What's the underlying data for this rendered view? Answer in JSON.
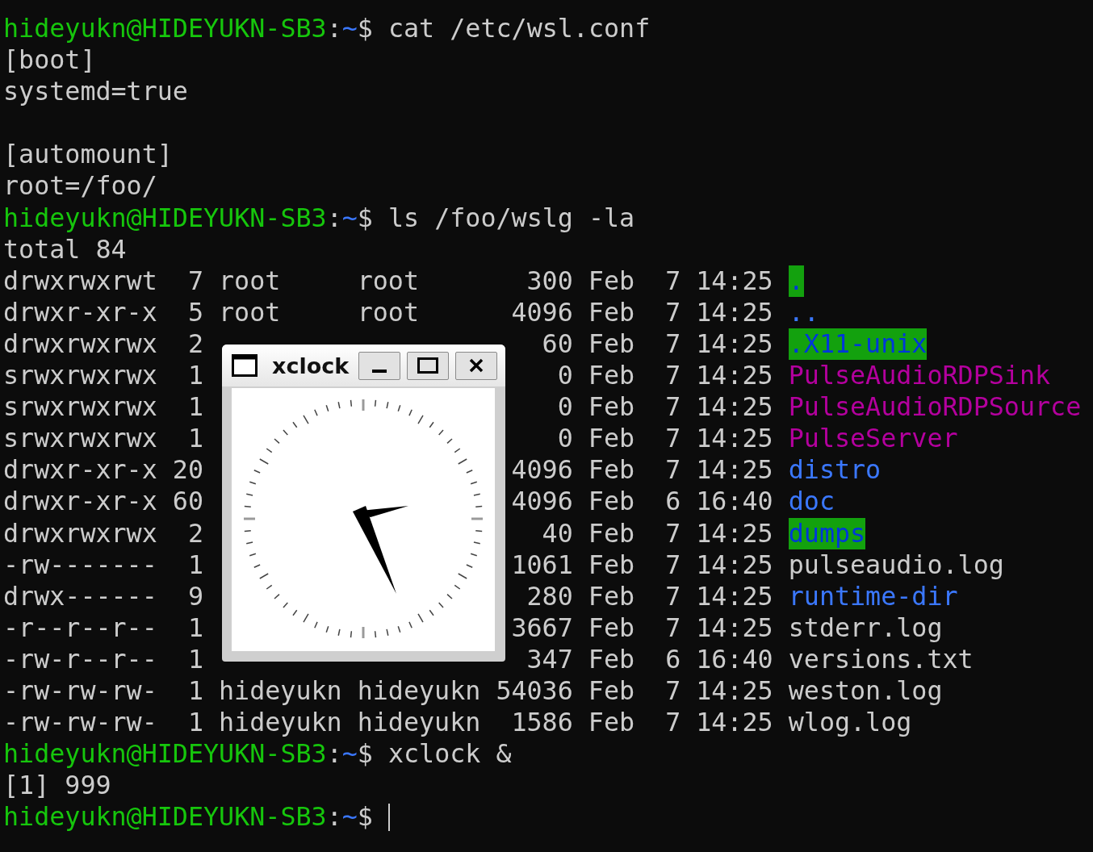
{
  "terminal": {
    "lines": [
      {
        "kind": "prompt",
        "user_host": "hideyukn@HIDEYUKN-SB3",
        "separator": ":",
        "path": "~",
        "symbol": "$",
        "command": "cat /etc/wsl.conf",
        "cursor": false
      },
      {
        "kind": "output",
        "text": "[boot]"
      },
      {
        "kind": "output",
        "text": "systemd=true"
      },
      {
        "kind": "blank"
      },
      {
        "kind": "output",
        "text": "[automount]"
      },
      {
        "kind": "output",
        "text": "root=/foo/"
      },
      {
        "kind": "prompt",
        "user_host": "hideyukn@HIDEYUKN-SB3",
        "separator": ":",
        "path": "~",
        "symbol": "$",
        "command": "ls /foo/wslg -la",
        "cursor": false
      },
      {
        "kind": "output",
        "text": "total 84"
      },
      {
        "kind": "entry",
        "mode": "drwxrwxrwt",
        "links": "7",
        "owner": "root",
        "group": "root",
        "size": "300",
        "month": "Feb",
        "day": "7",
        "time": "14:25",
        "name": ".",
        "color": "#13a10e",
        "highlighted": true
      },
      {
        "kind": "entry",
        "mode": "drwxr-xr-x",
        "links": "5",
        "owner": "root",
        "group": "root",
        "size": "4096",
        "month": "Feb",
        "day": "7",
        "time": "14:25",
        "name": "..",
        "color": "#3b78ff",
        "highlighted": false
      },
      {
        "kind": "entry",
        "mode": "drwxrwxrwx",
        "links": "2",
        "size": "60",
        "month": "Feb",
        "day": "7",
        "time": "14:25",
        "name": ".X11-unix",
        "color": "#13a10e",
        "highlighted": true
      },
      {
        "kind": "entry",
        "mode": "srwxrwxrwx",
        "links": "1",
        "size": "0",
        "month": "Feb",
        "day": "7",
        "time": "14:25",
        "name": "PulseAudioRDPSink",
        "color": "#b4009e",
        "highlighted": false
      },
      {
        "kind": "entry",
        "mode": "srwxrwxrwx",
        "links": "1",
        "size": "0",
        "month": "Feb",
        "day": "7",
        "time": "14:25",
        "name": "PulseAudioRDPSource",
        "color": "#b4009e",
        "highlighted": false
      },
      {
        "kind": "entry",
        "mode": "srwxrwxrwx",
        "links": "1",
        "size": "0",
        "month": "Feb",
        "day": "7",
        "time": "14:25",
        "name": "PulseServer",
        "color": "#b4009e",
        "highlighted": false
      },
      {
        "kind": "entry",
        "mode": "drwxr-xr-x",
        "links": "20",
        "size": "4096",
        "month": "Feb",
        "day": "7",
        "time": "14:25",
        "name": "distro",
        "color": "#3b78ff",
        "highlighted": false
      },
      {
        "kind": "entry",
        "mode": "drwxr-xr-x",
        "links": "60",
        "size": "4096",
        "month": "Feb",
        "day": "6",
        "time": "16:40",
        "name": "doc",
        "color": "#3b78ff",
        "highlighted": false
      },
      {
        "kind": "entry",
        "mode": "drwxrwxrwx",
        "links": "2",
        "size": "40",
        "month": "Feb",
        "day": "7",
        "time": "14:25",
        "name": "dumps",
        "color": "#13a10e",
        "highlighted": true
      },
      {
        "kind": "entry",
        "mode": "-rw-------",
        "links": "1",
        "size": "1061",
        "month": "Feb",
        "day": "7",
        "time": "14:25",
        "name": "pulseaudio.log",
        "color": "#cccccc",
        "highlighted": false
      },
      {
        "kind": "entry",
        "mode": "drwx------",
        "links": "9",
        "size": "280",
        "month": "Feb",
        "day": "7",
        "time": "14:25",
        "name": "runtime-dir",
        "color": "#3b78ff",
        "highlighted": false
      },
      {
        "kind": "entry",
        "mode": "-r--r--r--",
        "links": "1",
        "size": "3667",
        "month": "Feb",
        "day": "7",
        "time": "14:25",
        "name": "stderr.log",
        "color": "#cccccc",
        "highlighted": false
      },
      {
        "kind": "entry",
        "mode": "-rw-r--r--",
        "links": "1",
        "size": "347",
        "month": "Feb",
        "day": "6",
        "time": "16:40",
        "name": "versions.txt",
        "color": "#cccccc",
        "highlighted": false
      },
      {
        "kind": "entry",
        "mode": "-rw-rw-rw-",
        "links": "1",
        "owner": "hideyukn",
        "group": "hideyukn",
        "size": "54036",
        "month": "Feb",
        "day": "7",
        "time": "14:25",
        "name": "weston.log",
        "color": "#cccccc",
        "highlighted": false
      },
      {
        "kind": "entry",
        "mode": "-rw-rw-rw-",
        "links": "1",
        "owner": "hideyukn",
        "group": "hideyukn",
        "size": "1586",
        "month": "Feb",
        "day": "7",
        "time": "14:25",
        "name": "wlog.log",
        "color": "#cccccc",
        "highlighted": false
      },
      {
        "kind": "prompt",
        "user_host": "hideyukn@HIDEYUKN-SB3",
        "separator": ":",
        "path": "~",
        "symbol": "$",
        "command": "xclock &",
        "cursor": false
      },
      {
        "kind": "output",
        "text": "[1] 999"
      },
      {
        "kind": "prompt",
        "user_host": "hideyukn@HIDEYUKN-SB3",
        "separator": ":",
        "path": "~",
        "symbol": "$",
        "cursor": true
      }
    ]
  },
  "xclock_window": {
    "title": "xclock"
  }
}
